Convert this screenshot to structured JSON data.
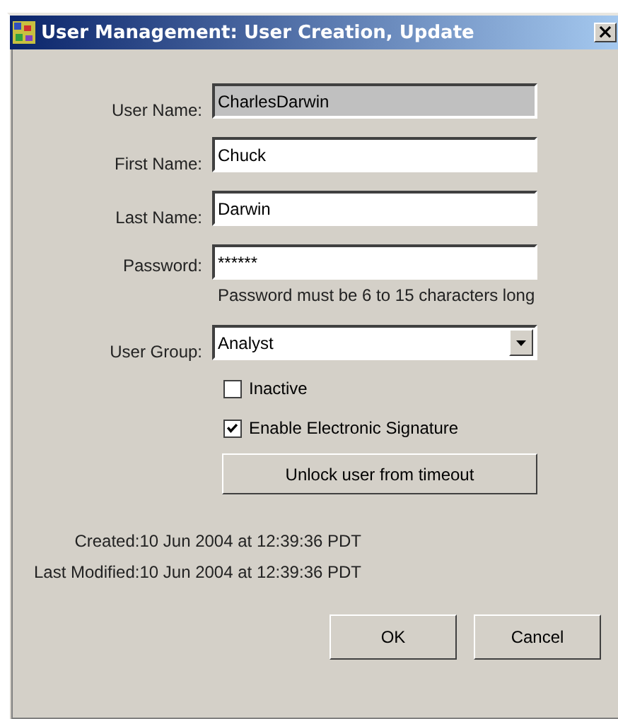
{
  "window": {
    "title": "User Management: User Creation, Update",
    "close": "×"
  },
  "fields": [
    {
      "label": "User Name:",
      "kind": "text",
      "value": "CharlesDarwin",
      "disabled": true
    },
    {
      "label": "First Name:",
      "kind": "text",
      "value": "Chuck",
      "disabled": false
    },
    {
      "label": "Last Name:",
      "kind": "text",
      "value": "Darwin",
      "disabled": false
    },
    {
      "label": "Password:",
      "kind": "password",
      "value": "******",
      "disabled": false,
      "hint": "Password must be 6 to 15 characters long"
    },
    {
      "label": "User Group:",
      "kind": "select",
      "value": "Analyst",
      "disabled": false
    }
  ],
  "checkboxes": [
    {
      "label": "Inactive",
      "checked": false
    },
    {
      "label": "Enable Electronic Signature",
      "checked": true
    }
  ],
  "unlock_button": "Unlock user from timeout",
  "info": [
    {
      "label": "Created:",
      "value": "10 Jun 2004 at 12:39:36 PDT"
    },
    {
      "label": "Last Modified:",
      "value": "10 Jun 2004 at 12:39:36 PDT"
    }
  ],
  "buttons": [
    "OK",
    "Cancel"
  ]
}
